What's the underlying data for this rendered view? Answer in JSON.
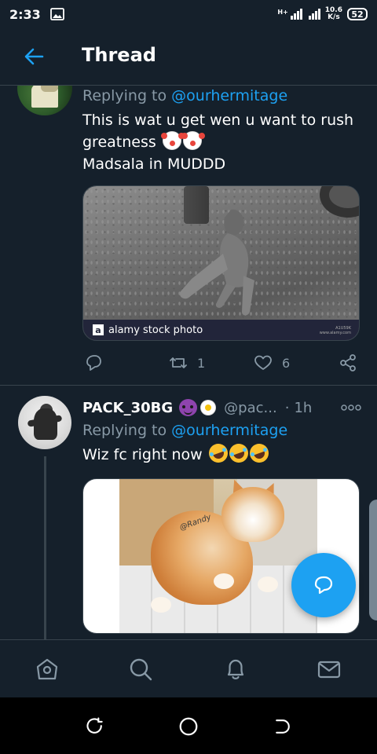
{
  "status_bar": {
    "time": "2:33",
    "network_type": "H+",
    "speed_value": "10.6",
    "speed_unit": "K/s",
    "battery": "52"
  },
  "header": {
    "back_icon": "arrow-left-icon",
    "title": "Thread"
  },
  "tweet_1": {
    "reply_prefix": "Replying to",
    "reply_handle": "@ourhermitage",
    "text_line1": "This is wat u get wen u want to rush",
    "text_line2": "greatness",
    "text_line3": "Madsala in MUDDD",
    "emojis": [
      "clown-face",
      "clown-face"
    ],
    "image_watermark": "alamy stock photo",
    "image_watermark_logo": "a",
    "image_caption_small": "A1U59K",
    "image_caption_url": "www.alamy.com",
    "retweet_count": "1",
    "like_count": "6"
  },
  "tweet_2": {
    "display_name": "PACK_30BG",
    "name_emojis": [
      "smiling-face-with-horns",
      "blossom"
    ],
    "handle": "@pac...",
    "separator": "·",
    "time": "1h",
    "reply_prefix": "Replying to",
    "reply_handle": "@ourhermitage",
    "text": "Wiz fc right now",
    "emojis": [
      "rolling-on-the-floor-laughing",
      "rolling-on-the-floor-laughing",
      "rolling-on-the-floor-laughing"
    ],
    "image_watermark": "@Randy"
  },
  "fab": {
    "icon": "reply-bubble-icon"
  },
  "bottom_nav": {
    "items": [
      "home-icon",
      "search-icon",
      "notifications-icon",
      "messages-icon"
    ]
  },
  "android_nav": {
    "buttons": [
      "recents-icon",
      "home-circle-icon",
      "back-icon"
    ]
  },
  "colors": {
    "background": "#15202b",
    "accent": "#1da1f2",
    "muted": "#8899a6",
    "divider": "#38444d"
  }
}
